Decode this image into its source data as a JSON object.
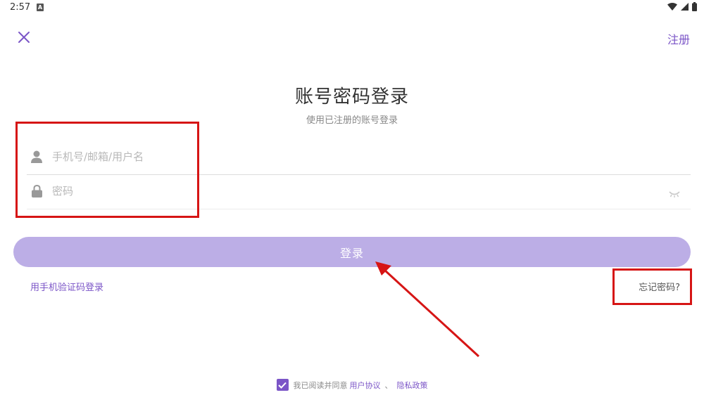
{
  "status_bar": {
    "time": "2:57",
    "notification_icon": "a-letter-icon",
    "icons": [
      "wifi-icon",
      "signal-icon",
      "battery-icon"
    ]
  },
  "top_bar": {
    "close_icon": "close-icon",
    "register_label": "注册"
  },
  "header": {
    "title": "账号密码登录",
    "subtitle": "使用已注册的账号登录"
  },
  "form": {
    "username_placeholder": "手机号/邮箱/用户名",
    "username_value": "",
    "password_placeholder": "密码",
    "password_value": "",
    "login_button_label": "登录",
    "sms_login_label": "用手机验证码登录",
    "forgot_password_label": "忘记密码?"
  },
  "agreement": {
    "checked": true,
    "text": "我已阅读并同意",
    "user_agreement_label": "用户协议",
    "separator": "、",
    "privacy_policy_label": "隐私政策"
  },
  "colors": {
    "accent": "#7b55c7",
    "login_button": "#bcaee6",
    "annotation": "#d61515"
  }
}
